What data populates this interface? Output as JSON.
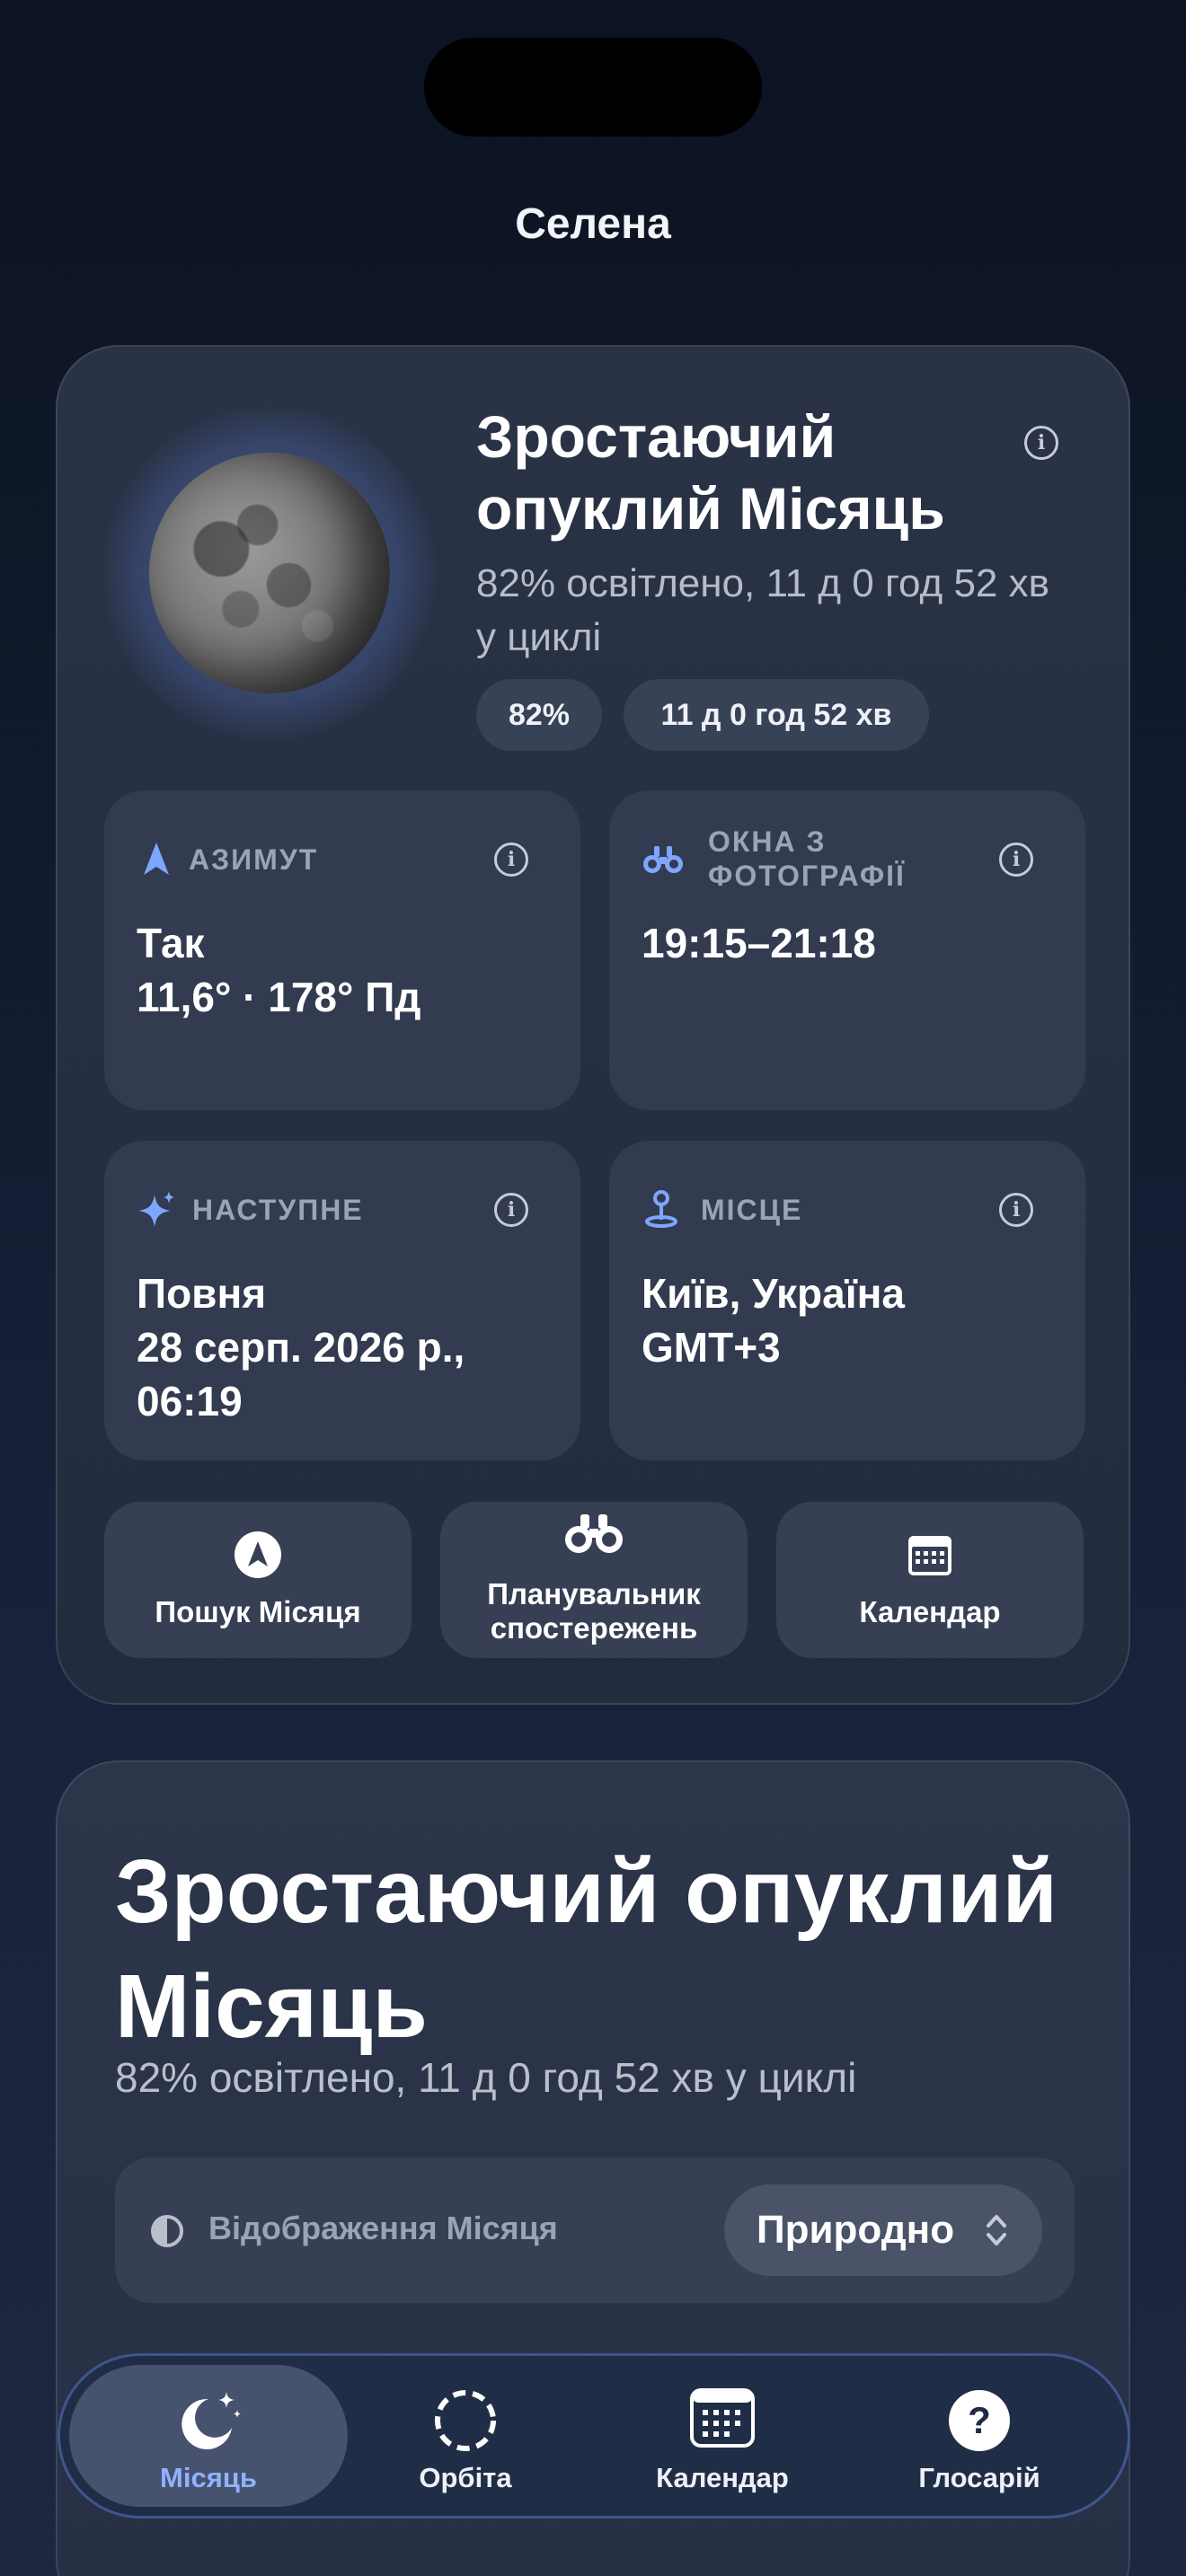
{
  "app": {
    "title": "Селена"
  },
  "summary": {
    "phase_name": "Зростаючий опуклий Місяць",
    "subtitle": "82% освітлено, 11 д 0 год 52 хв у циклі",
    "illumination_pill": "82%",
    "age_pill": "11 д 0 год 52 хв",
    "info_icon": "i"
  },
  "tiles": {
    "azimuth": {
      "label": "АЗИМУТ",
      "line1": "Так",
      "line2": "11,6° · 178° Пд",
      "icon": "navigation-arrow-icon"
    },
    "photo": {
      "label": "ОКНА З ФОТОГРАФІЇ",
      "value": "19:15–21:18",
      "icon": "binoculars-icon"
    },
    "next": {
      "label": "НАСТУПНЕ",
      "line1": "Повня",
      "line2": "28 серп. 2026 р.,",
      "line3": "06:19",
      "icon": "sparkles-icon"
    },
    "place": {
      "label": "МІСЦЕ",
      "line1": "Київ, Україна",
      "line2": "GMT+3",
      "icon": "location-pin-icon"
    }
  },
  "actions": {
    "find_moon": "Пошук Місяця",
    "planner_line1": "Планувальник",
    "planner_line2": "спостережень",
    "calendar": "Календар"
  },
  "detail": {
    "title": "Зростаючий опуклий Місяць",
    "subtitle": "82% освітлено, 11 д 0 год 52 хв у циклі",
    "display_label": "Відображення Місяця",
    "display_value": "Природно"
  },
  "tabs": {
    "moon": "Місяць",
    "orbit": "Орбіта",
    "calendar": "Календар",
    "glossary": "Глосарій"
  },
  "colors": {
    "accent": "#8fb2ff",
    "background": "#101a2c",
    "card": "#2a3346",
    "tile": "#323b4f"
  }
}
